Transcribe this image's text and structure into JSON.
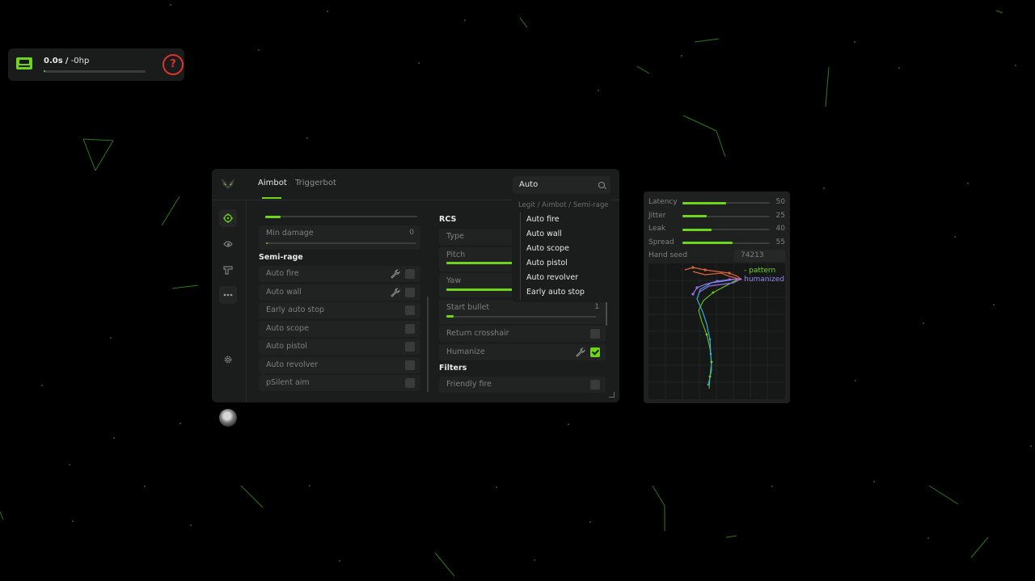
{
  "hud": {
    "time": "0.0s",
    "separator": "/",
    "hp": "-0hp",
    "progress": 0,
    "help_symbol": "?"
  },
  "colors": {
    "accent": "#6fd41c",
    "background": "#000000",
    "panel": "#1b1d1c",
    "danger": "#d9352e",
    "pattern": "#6fd41c",
    "humanized": "#8e84f5"
  },
  "panel": {
    "tabs": [
      {
        "label": "Aimbot",
        "active": true
      },
      {
        "label": "Triggerbot",
        "active": false
      }
    ],
    "search": {
      "value": "Auto"
    },
    "sidebar_icons": [
      "crosshair-icon",
      "eye-icon",
      "pistol-icon",
      "more-icon",
      "gear-icon",
      "avatar"
    ],
    "left": {
      "top_slider_fraction": 0.1,
      "min_damage": {
        "label": "Min damage",
        "value": "0",
        "fraction": 0
      },
      "section_title": "Semi-rage",
      "options": [
        {
          "label": "Auto fire",
          "wrench": true,
          "checked": false
        },
        {
          "label": "Auto wall",
          "wrench": true,
          "checked": false
        },
        {
          "label": "Early auto stop",
          "wrench": false,
          "checked": false
        },
        {
          "label": "Auto scope",
          "wrench": false,
          "checked": false
        },
        {
          "label": "Auto pistol",
          "wrench": false,
          "checked": false
        },
        {
          "label": "Auto revolver",
          "wrench": false,
          "checked": false
        },
        {
          "label": "pSilent aim",
          "wrench": false,
          "checked": false
        }
      ]
    },
    "right": {
      "section_title": "RCS",
      "type_label": "Type",
      "pitch": {
        "label": "Pitch",
        "fraction": 0.5
      },
      "yaw": {
        "label": "Yaw",
        "fraction": 0.5
      },
      "start_bullet": {
        "label": "Start bullet",
        "value": "1",
        "fraction": 0.05
      },
      "options": [
        {
          "label": "Return crosshair",
          "wrench": false,
          "checked": false
        },
        {
          "label": "Humanize",
          "wrench": true,
          "checked": true
        }
      ],
      "filters_title": "Filters",
      "filters": [
        {
          "label": "Friendly fire",
          "wrench": false,
          "checked": false
        }
      ]
    }
  },
  "dropdown": {
    "breadcrumb": "Legit / Aimbot / Semi-rage",
    "items": [
      "Auto fire",
      "Auto wall",
      "Auto scope",
      "Auto pistol",
      "Auto revolver",
      "Early auto stop"
    ]
  },
  "stats": {
    "rows": [
      {
        "label": "Latency",
        "value": "50",
        "fraction": 0.5
      },
      {
        "label": "Jitter",
        "value": "25",
        "fraction": 0.28
      },
      {
        "label": "Leak",
        "value": "40",
        "fraction": 0.33
      },
      {
        "label": "Spread",
        "value": "55",
        "fraction": 0.57
      }
    ],
    "seed_label": "Hand seed",
    "seed_value": "74213",
    "legend": {
      "pattern": "- pattern",
      "humanized": "- humanized"
    }
  }
}
